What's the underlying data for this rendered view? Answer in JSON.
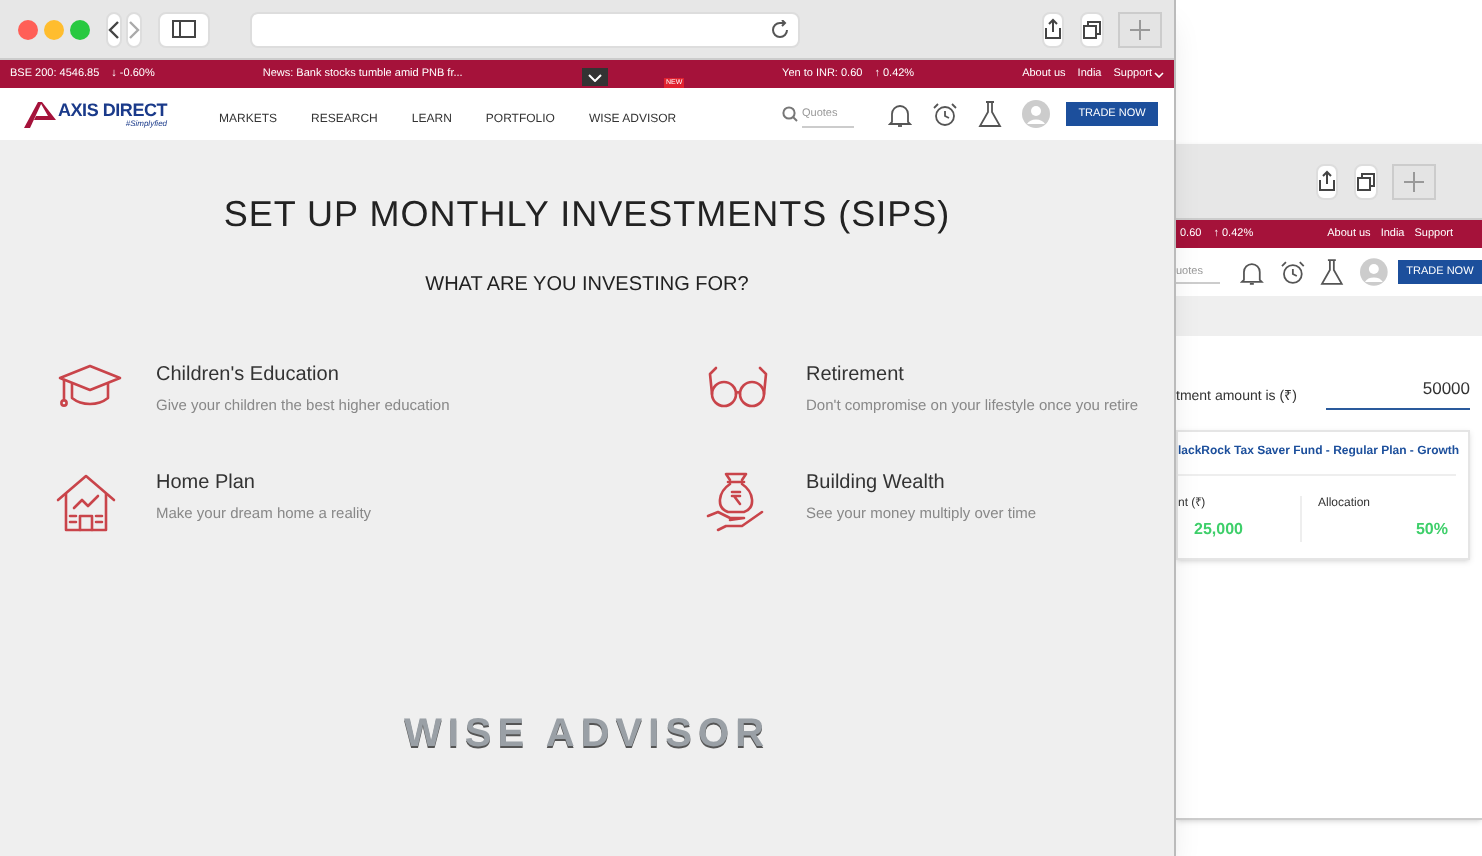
{
  "front_window": {
    "ticker": {
      "index": "BSE 200: 4546.85",
      "index_change": "↓ -0.60%",
      "news": "News: Bank stocks tumble amid PNB fr...",
      "currency": "Yen to INR: 0.60",
      "currency_change": "↑ 0.42%",
      "links": [
        "About us",
        "India",
        "Support"
      ]
    },
    "nav": {
      "logo": "AXIS DIRECT",
      "tagline": "#Simplyfied",
      "menu": [
        {
          "label": "MARKETS"
        },
        {
          "label": "RESEARCH"
        },
        {
          "label": "LEARN"
        },
        {
          "label": "PORTFOLIO"
        },
        {
          "label": "WISE ADVISOR",
          "badge": "NEW"
        }
      ],
      "search": {
        "placeholder": "Quotes"
      },
      "cta": "TRADE NOW"
    },
    "page": {
      "title": "SET UP MONTHLY INVESTMENTS (SIPS)",
      "subtitle": "WHAT ARE YOU INVESTING FOR?",
      "goals": [
        {
          "kind": "graduation",
          "title": "Children's Education",
          "description": "Give your children the best higher education"
        },
        {
          "kind": "glasses",
          "title": "Retirement",
          "description": "Don't compromise on your lifestyle once you retire"
        },
        {
          "kind": "house",
          "title": "Home Plan",
          "description": "Make your dream home a reality"
        },
        {
          "kind": "moneybag",
          "title": "Building Wealth",
          "description": "See your money multiply over time"
        }
      ],
      "brand": "WISE ADVISOR"
    }
  },
  "back_window": {
    "ticker": {
      "currency": "0.60",
      "currency_change": "↑ 0.42%",
      "links": [
        "About us",
        "India",
        "Support"
      ]
    },
    "nav": {
      "search": {
        "placeholder": "uotes"
      },
      "cta": "TRADE NOW"
    },
    "amount": {
      "label": "tment amount is (₹)",
      "value": "50000"
    },
    "fund": {
      "name": "lackRock Tax Saver Fund - Regular Plan - Growth",
      "amount_label": "nt (₹)",
      "amount": "25,000",
      "allocation_label": "Allocation",
      "allocation": "50%"
    }
  }
}
